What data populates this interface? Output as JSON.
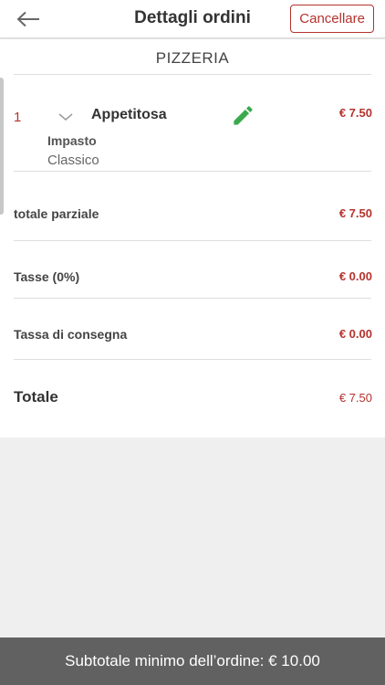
{
  "header": {
    "title": "Dettagli ordini",
    "cancel_label": "Cancellare",
    "back_icon": "arrow-left-icon"
  },
  "restaurant": {
    "name": "PIZZERIA"
  },
  "order_items": [
    {
      "quantity": "1",
      "name": "Appetitosa",
      "price": "€ 7.50",
      "options": [
        {
          "label": "Impasto",
          "value": "Classico"
        }
      ],
      "expand_icon": "chevron-down-icon",
      "edit_icon": "pencil-icon"
    }
  ],
  "summary": {
    "subtotal_label": "totale parziale",
    "subtotal_value": "€ 7.50",
    "tax_label": "Tasse (0%)",
    "tax_value": "€ 0.00",
    "delivery_label": "Tassa di consegna",
    "delivery_value": "€ 0.00",
    "total_label": "Totale",
    "total_value": "€ 7.50"
  },
  "footer": {
    "minimum_order_text": "Subtotale minimo dell’ordine: € 10.00"
  },
  "colors": {
    "accent": "#b5322e",
    "edit_icon": "#3aaa4d",
    "footer_bg": "#616161"
  }
}
